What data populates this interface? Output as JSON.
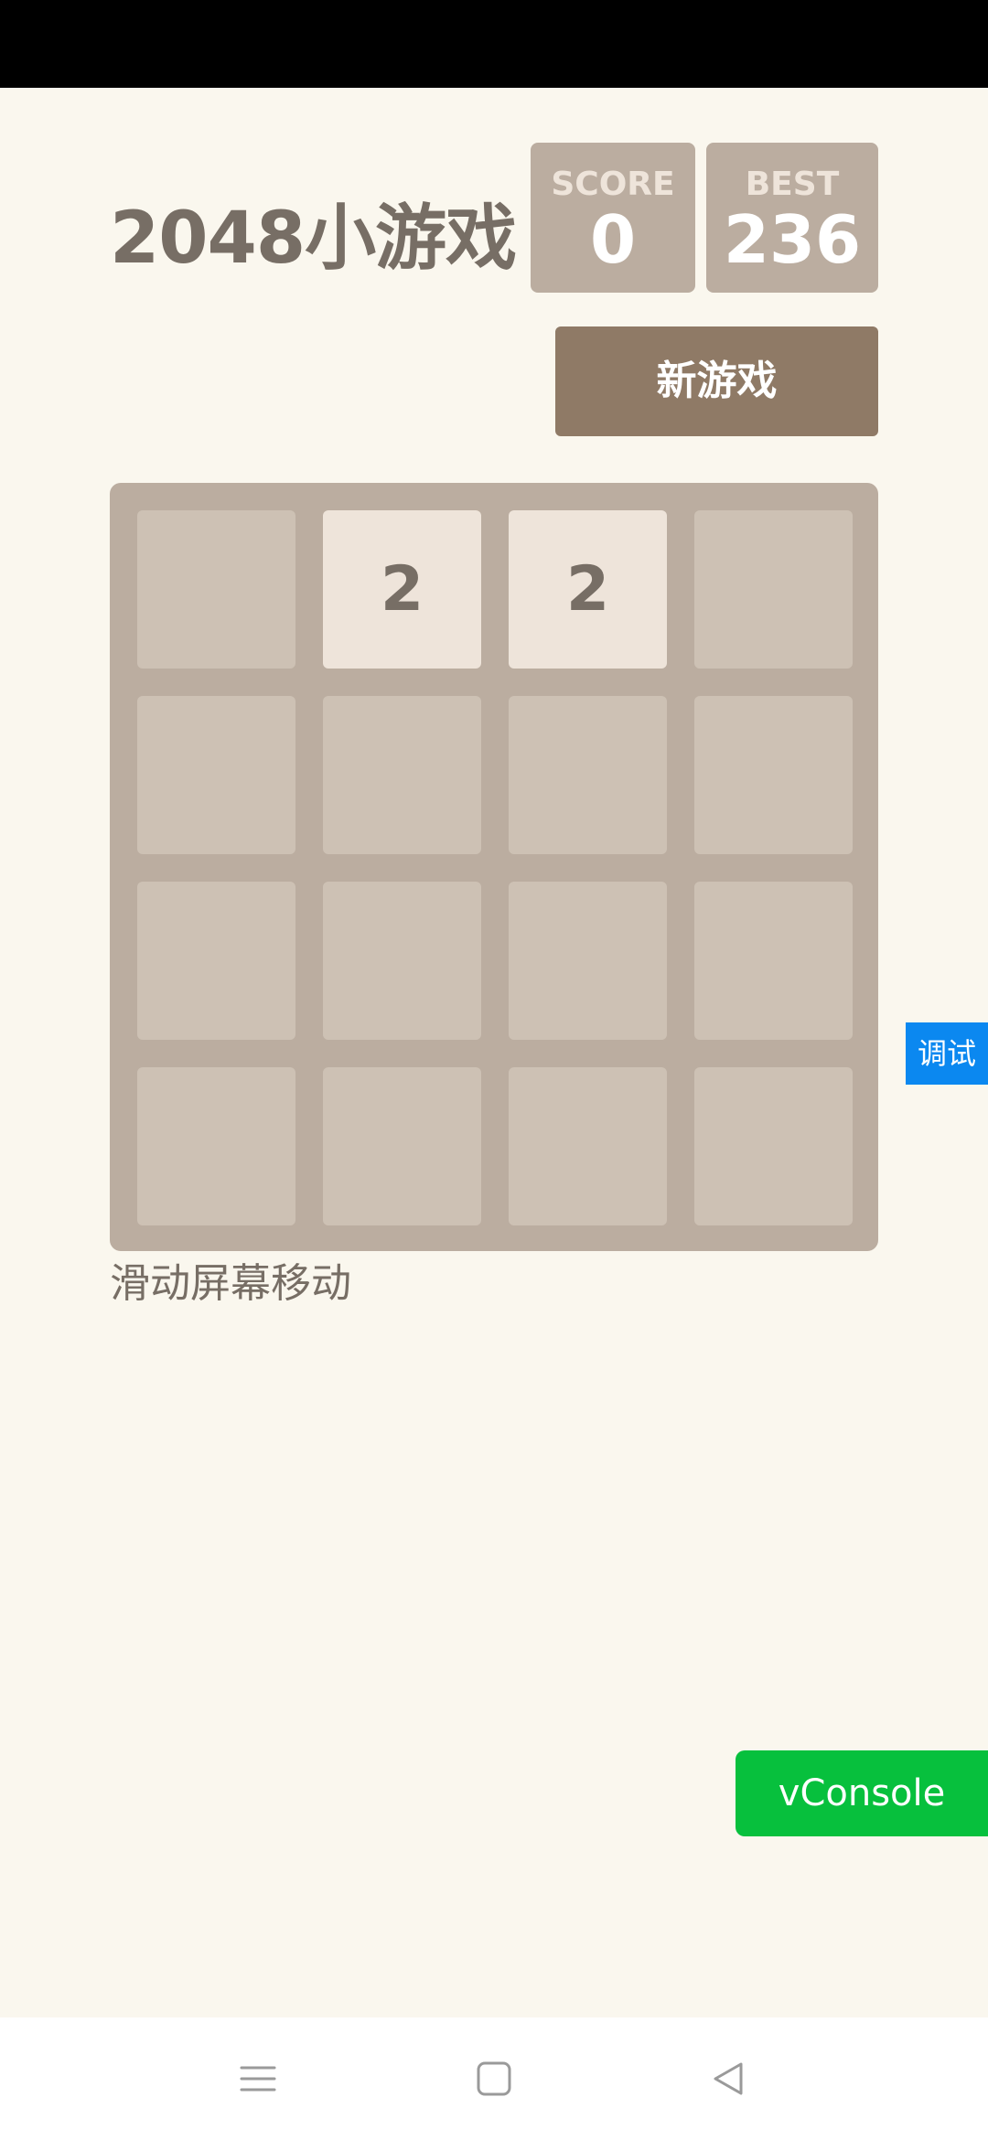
{
  "game": {
    "title": "2048小游戏",
    "score_label": "SCORE",
    "score_value": "0",
    "best_label": "BEST",
    "best_value": "236",
    "new_game_label": "新游戏",
    "hint": "滑动屏幕移动"
  },
  "board": {
    "rows": [
      [
        "",
        "2",
        "2",
        ""
      ],
      [
        "",
        "",
        "",
        ""
      ],
      [
        "",
        "",
        "",
        ""
      ],
      [
        "",
        "",
        "",
        ""
      ]
    ]
  },
  "overlay": {
    "debug_label": "调试",
    "vconsole_label": "vConsole"
  },
  "icons": {
    "nav_menu": "menu-lines-icon",
    "nav_home": "square-home-icon",
    "nav_back": "triangle-back-icon"
  },
  "colors": {
    "background": "#faf7ee",
    "board": "#bbada0",
    "empty_cell": "#cdc1b4",
    "tile_2": "#eee4da",
    "text": "#776e65",
    "new_game_button": "#8f7a66",
    "debug_tab": "#0b88f0",
    "vconsole": "#07c03d"
  }
}
